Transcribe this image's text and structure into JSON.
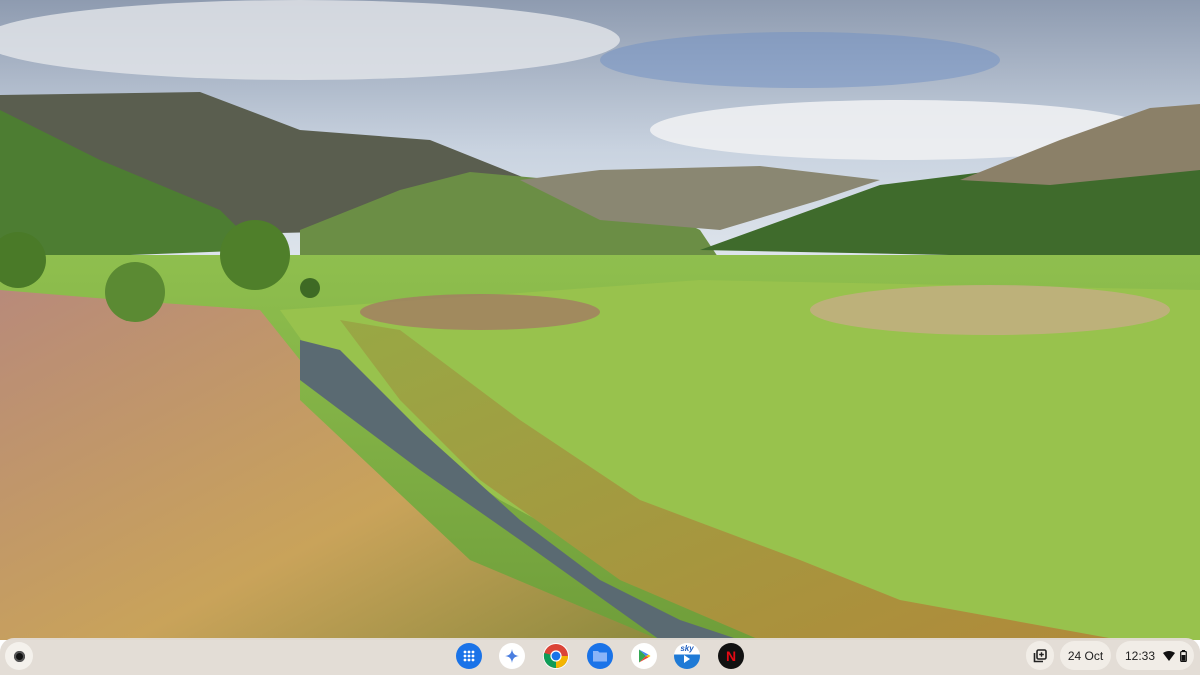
{
  "desktop": {
    "wallpaper": "valley-landscape-with-stream"
  },
  "shelf": {
    "launcher": {
      "icon": "launcher-icon"
    },
    "pinned_apps": [
      {
        "name": "App Launcher",
        "icon": "app-grid-icon",
        "color": "#1a73e8"
      },
      {
        "name": "Gemini",
        "icon": "gemini-icon",
        "color": "#4285f4"
      },
      {
        "name": "Chrome",
        "icon": "chrome-icon",
        "color": "#db4437"
      },
      {
        "name": "Files",
        "icon": "files-icon",
        "color": "#1a73e8"
      },
      {
        "name": "Play Store",
        "icon": "play-store-icon",
        "color": "#34a853"
      },
      {
        "name": "Sky Go",
        "icon": "sky-icon",
        "label": "sky",
        "color": "#0072c9"
      },
      {
        "name": "Netflix",
        "icon": "netflix-icon",
        "label": "N",
        "color": "#e50914"
      }
    ],
    "tray": {
      "screenshot_icon": "capture-mode-icon",
      "date": "24 Oct",
      "time": "12:33",
      "wifi_icon": "wifi-icon",
      "battery_icon": "battery-icon"
    }
  }
}
